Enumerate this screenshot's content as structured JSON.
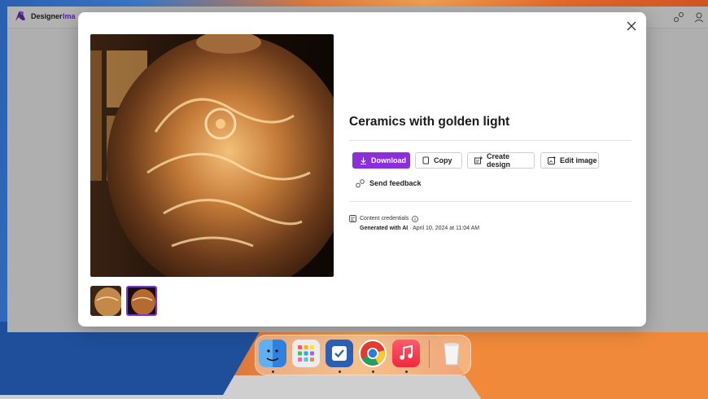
{
  "app": {
    "title": "Designer",
    "subtitle": "Ima"
  },
  "dialog": {
    "image_title": "Ceramics with golden light",
    "buttons": {
      "download": "Download",
      "copy": "Copy",
      "create_design": "Create design",
      "edit_image": "Edit image"
    },
    "send_feedback": "Send feedback",
    "credentials": {
      "label": "Content credentials",
      "generated": "Generated with AI",
      "date": " · April 10, 2024 at 11:04 AM"
    }
  },
  "dock": {
    "apps": [
      "finder-icon",
      "launchpad-icon",
      "tasks-icon",
      "chrome-icon",
      "music-icon",
      "trash-icon"
    ]
  },
  "colors": {
    "accent": "#8a2fd9",
    "thumb_border": "#7b35d8"
  }
}
